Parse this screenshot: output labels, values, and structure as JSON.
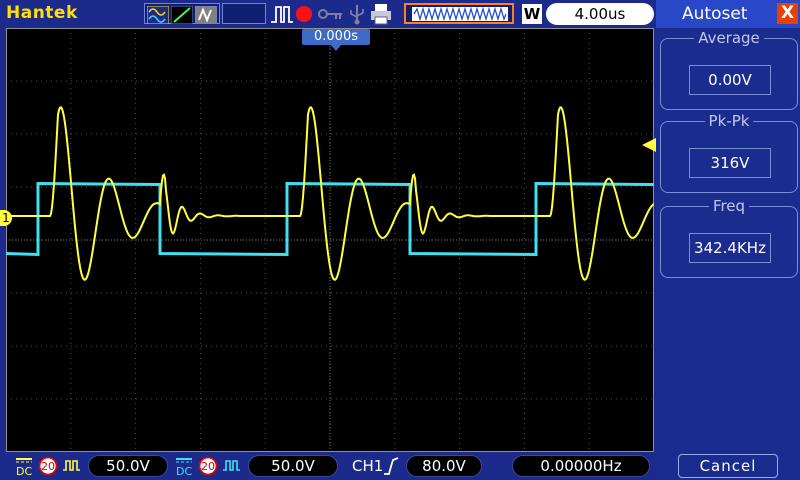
{
  "header": {
    "brand": "Hantek",
    "timebase": "4.00us",
    "mode_letter": "W",
    "trigger_time": "0.000s",
    "icons": [
      "waveform-icon",
      "line-icon",
      "persist-icon",
      "pulse-icon",
      "record-dot-icon",
      "key-icon",
      "print-icon",
      "memory-waveform-icon"
    ]
  },
  "footer": {
    "ch1_coupling": "DC",
    "ch1_bw": "20",
    "ch1_volts": "50.0V",
    "ch2_coupling": "DC",
    "ch2_bw": "20",
    "ch2_volts": "50.0V",
    "trigger_source": "CH1",
    "trigger_level": "80.0V",
    "frequency": "0.00000Hz"
  },
  "panel": {
    "title": "Autoset",
    "close_label": "X",
    "groups": [
      {
        "label": "Average",
        "value": "0.00V"
      },
      {
        "label": "Pk-Pk",
        "value": "316V"
      },
      {
        "label": "Freq",
        "value": "342.4KHz"
      }
    ],
    "cancel_label": "Cancel"
  },
  "colors": {
    "ch1": "#ffff40",
    "ch2": "#40e0f0",
    "bar": "#1c2a8c",
    "panel": "#1a2c8e"
  },
  "channel_markers": {
    "ch1": "1"
  }
}
